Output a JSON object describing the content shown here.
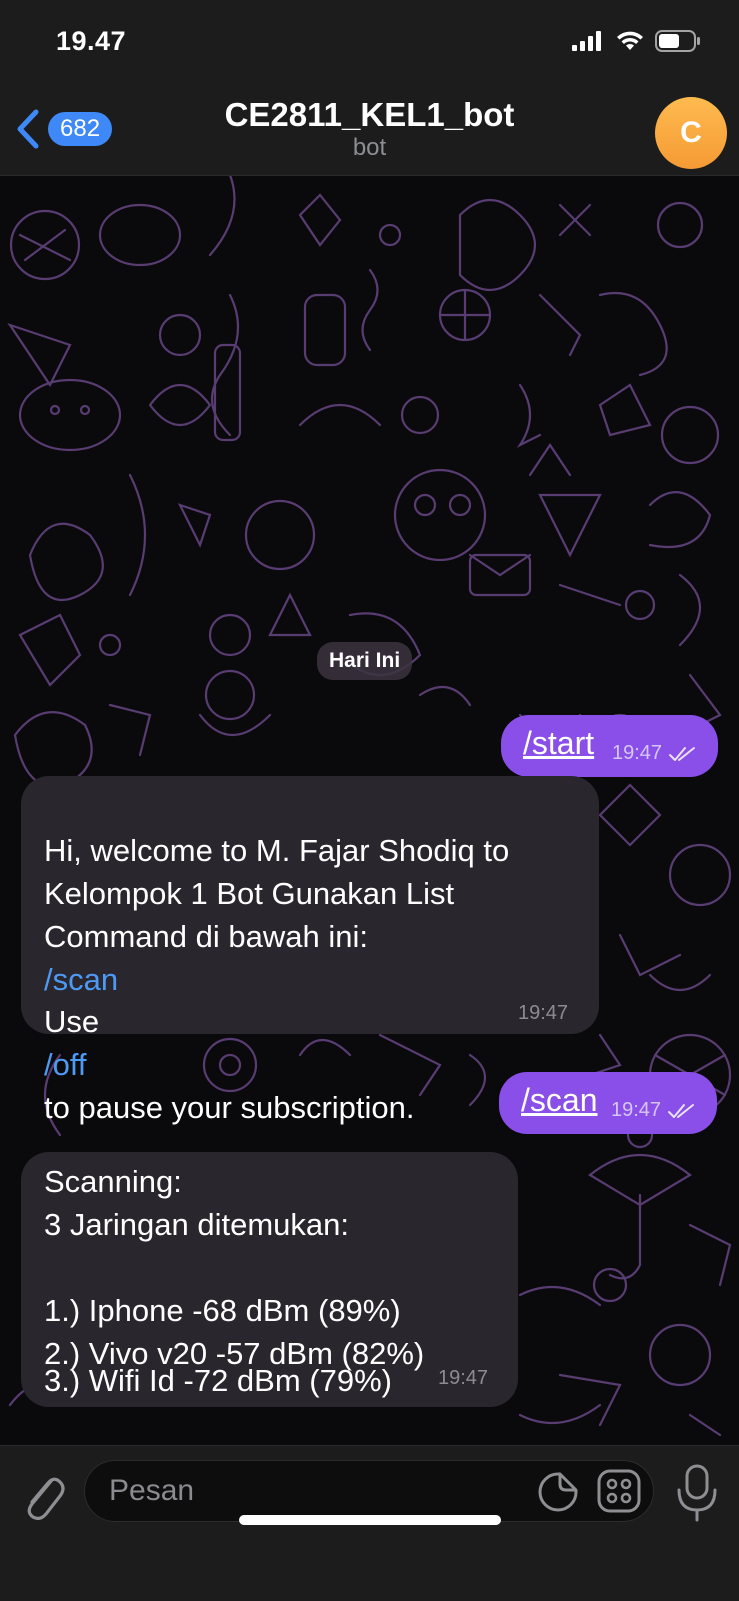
{
  "status_bar": {
    "time": "19.47"
  },
  "header": {
    "back_count": "682",
    "title": "CE2811_KEL1_bot",
    "subtitle": "bot",
    "avatar_letter": "C",
    "avatar_color": "#f7a43f",
    "accent_color": "#3e88f7"
  },
  "chat": {
    "date_label": "Hari Ini",
    "messages": [
      {
        "direction": "outgoing",
        "command": "/start",
        "time": "19:47",
        "status": "read"
      },
      {
        "direction": "incoming",
        "text_before": "Hi, welcome to M. Fajar Shodiq to Kelompok 1 Bot Gunakan List Command di bawah ini:",
        "command_1": "/scan",
        "text_use": "Use",
        "command_2": "/off",
        "text_after": "to pause your subscription.",
        "time": "19:47"
      },
      {
        "direction": "outgoing",
        "command": "/scan",
        "time": "19:47",
        "status": "read"
      },
      {
        "direction": "incoming",
        "line_1": "Scanning:",
        "line_2": "3 Jaringan ditemukan:",
        "networks": [
          "1.) Iphone -68 dBm (89%)",
          "2.) Vivo v20 -57 dBm (82%)",
          "3.) Wifi Id -72 dBm (79%)"
        ],
        "time": "19:47"
      }
    ],
    "outgoing_bubble_color": "#8a4fe8",
    "incoming_bubble_color": "#2a262e"
  },
  "composer": {
    "placeholder": "Pesan",
    "attach_icon": "paperclip-icon",
    "sticker_icon": "sticker-icon",
    "apps_icon": "apps-icon",
    "mic_icon": "microphone-icon"
  }
}
